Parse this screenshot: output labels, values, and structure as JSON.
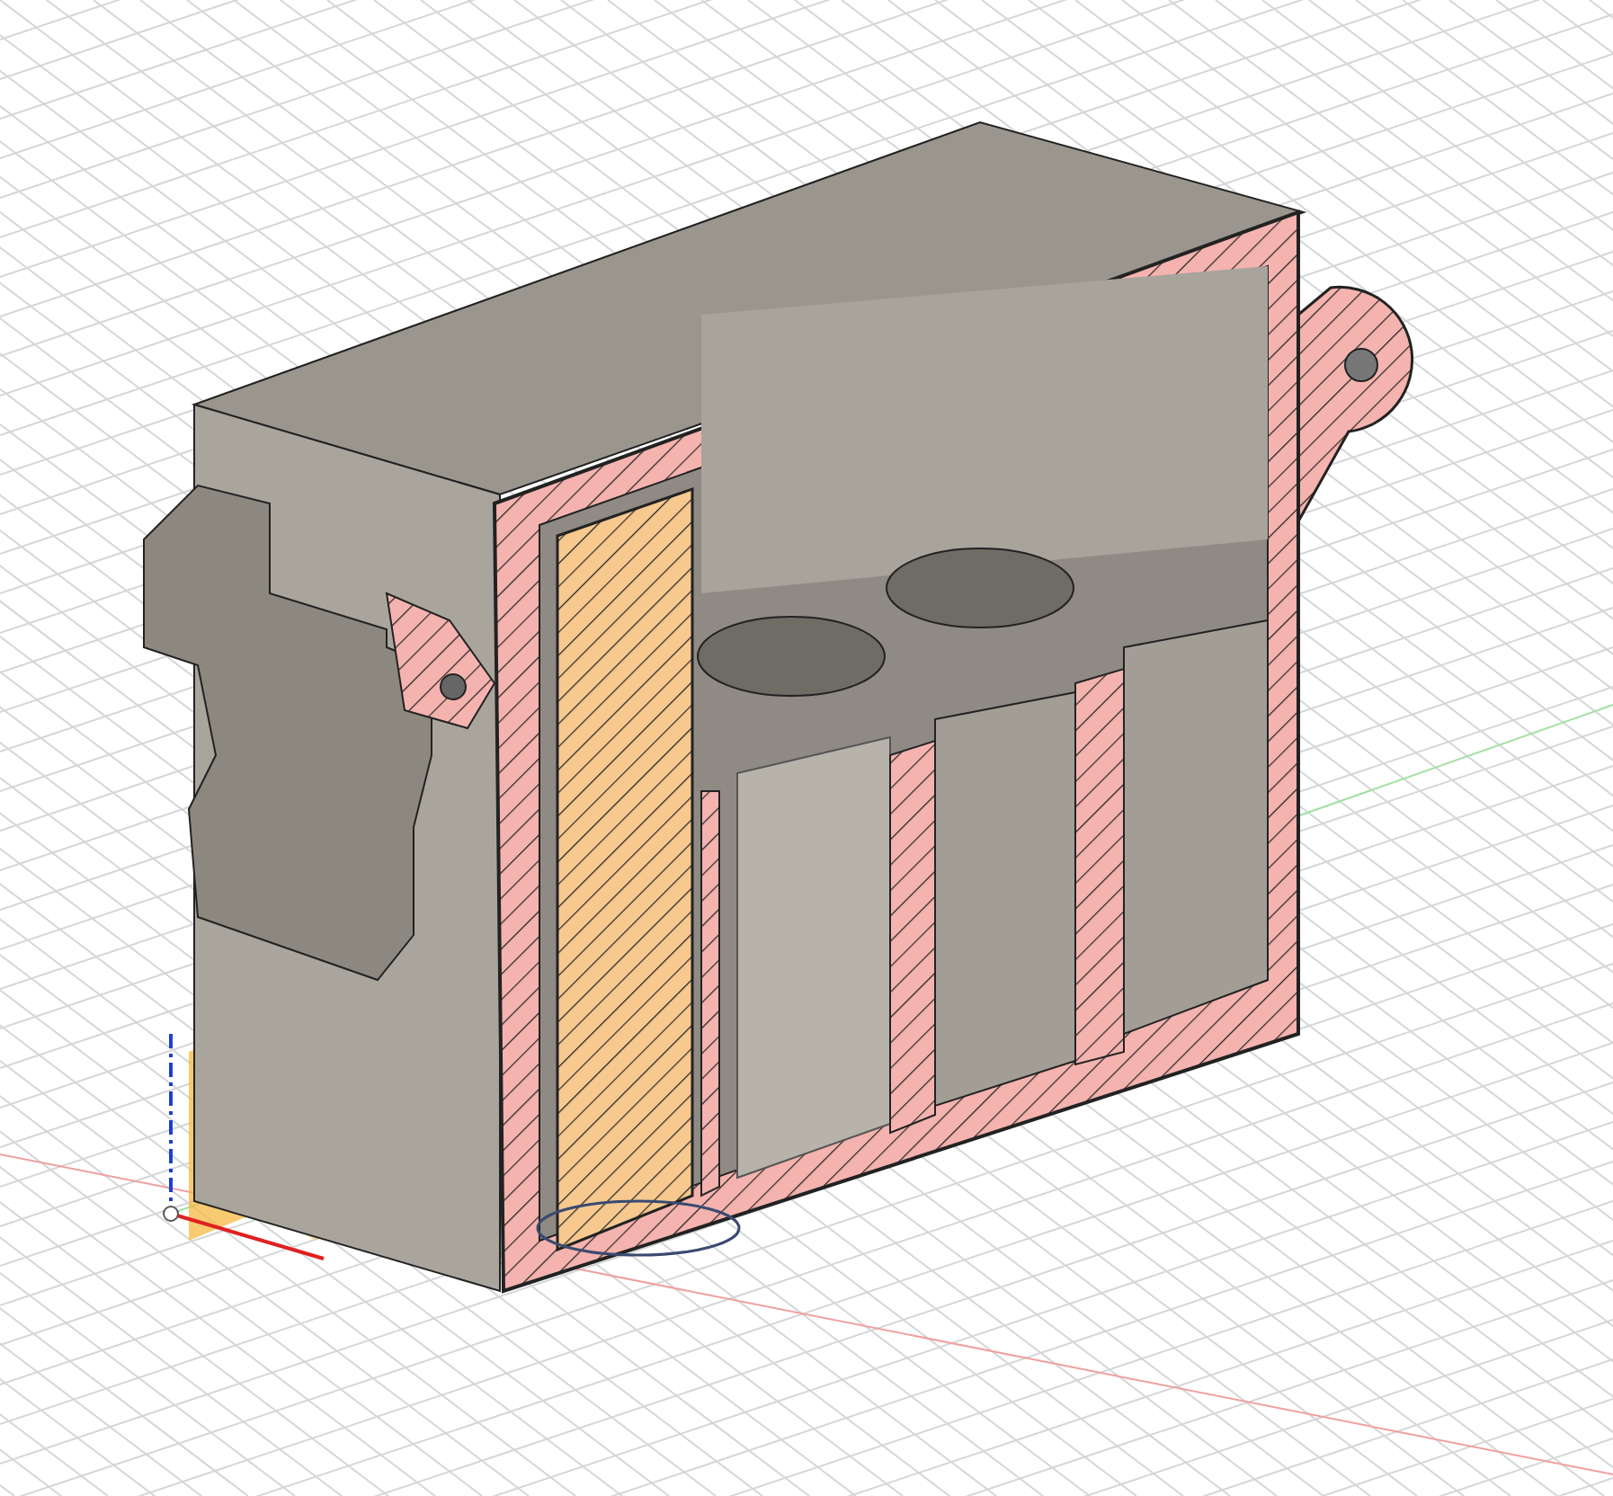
{
  "viewport": {
    "kind": "section-view",
    "show_grid": true,
    "show_origin": true
  }
}
